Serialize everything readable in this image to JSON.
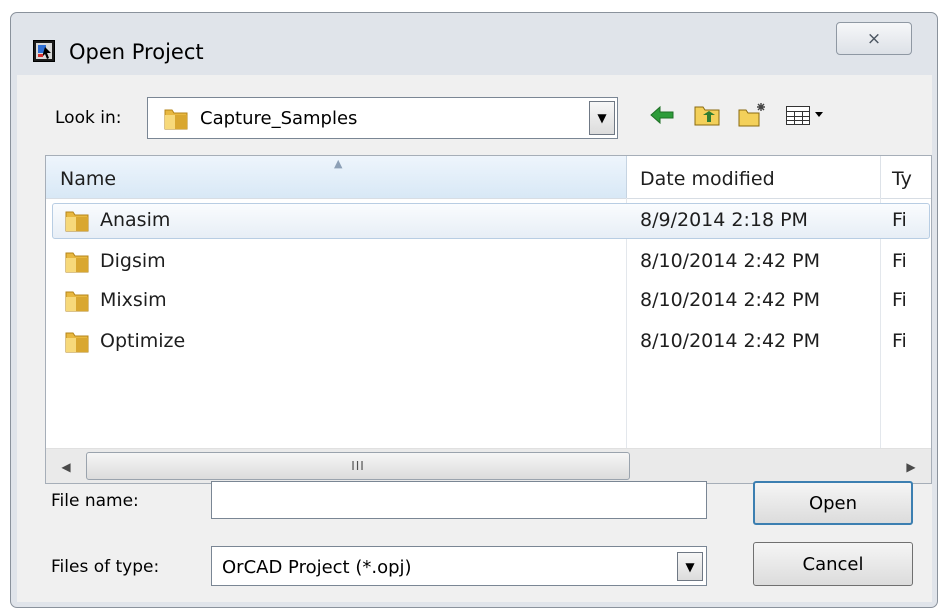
{
  "window": {
    "title": "Open Project",
    "close_glyph": "⨯"
  },
  "lookin": {
    "label": "Look in:",
    "value": "Capture_Samples"
  },
  "toolbar": [
    "back-arrow-icon",
    "up-folder-icon",
    "new-folder-icon",
    "view-menu-icon"
  ],
  "columns": {
    "name": "Name",
    "date": "Date modified",
    "type": "Ty"
  },
  "files": [
    {
      "name": "Anasim",
      "date": "8/9/2014 2:18 PM",
      "type": "Fi",
      "selected": true
    },
    {
      "name": "Digsim",
      "date": "8/10/2014 2:42 PM",
      "type": "Fi"
    },
    {
      "name": "Mixsim",
      "date": "8/10/2014 2:42 PM",
      "type": "Fi"
    },
    {
      "name": "Optimize",
      "date": "8/10/2014 2:42 PM",
      "type": "Fi"
    }
  ],
  "filename": {
    "label": "File name:",
    "value": ""
  },
  "filetype": {
    "label": "Files of type:",
    "value": "OrCAD Project (*.opj)"
  },
  "buttons": {
    "open": "Open",
    "cancel": "Cancel"
  },
  "colors": {
    "selection_border": "#b8cde3",
    "header_gradient": "#d8e8f6",
    "dialog_bg": "#f0f0f0"
  }
}
